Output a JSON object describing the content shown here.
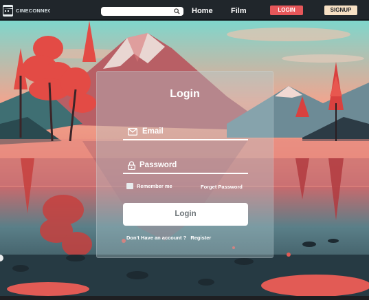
{
  "navbar": {
    "brand": "CINECONNECT",
    "search": {
      "placeholder": ""
    },
    "links": [
      "Home",
      "Film"
    ],
    "login_label": "LOGIN",
    "signup_label": "SIGNUP",
    "login_color": "#e6575a",
    "signup_color": "#f6e0c4"
  },
  "login_card": {
    "title": "Login",
    "email_label": "Email",
    "password_label": "Password",
    "remember_label": "Remember me",
    "forgot_label": "Forget Password",
    "submit_label": "Login",
    "no_account_text": "Don't Have an account ?",
    "register_label": "Register"
  },
  "icons": [
    "film-logo-icon",
    "search-icon",
    "envelope-icon",
    "lock-icon"
  ]
}
